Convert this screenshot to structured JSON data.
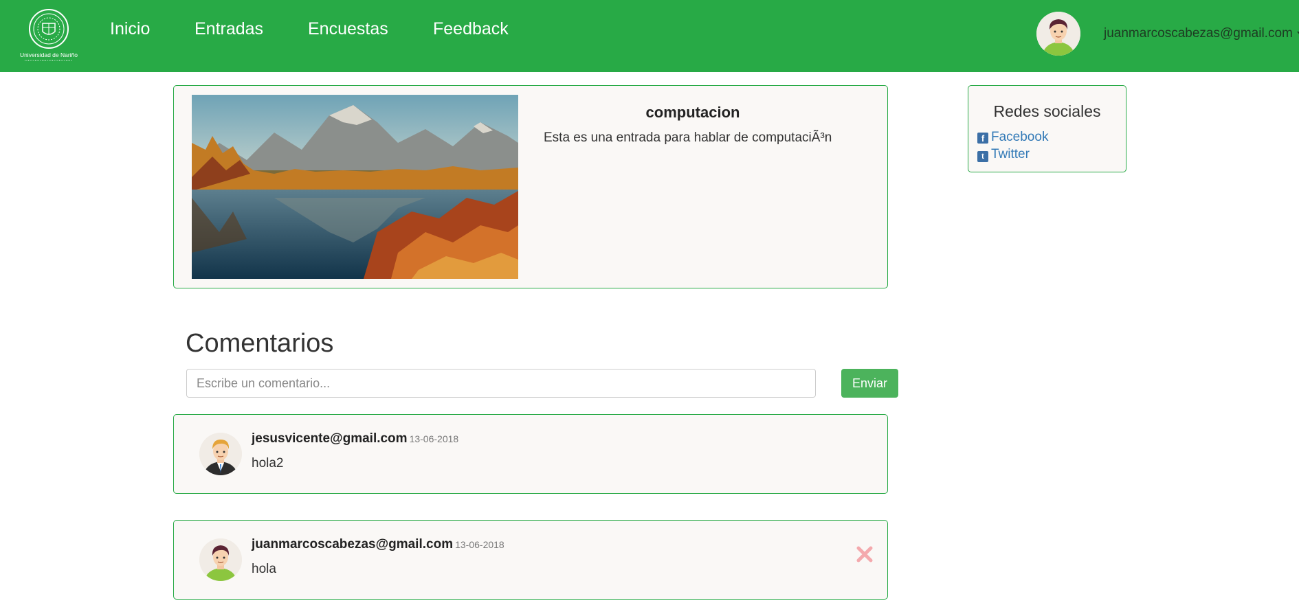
{
  "navbar": {
    "logo_text": "Universidad de Nariño",
    "links": [
      "Inicio",
      "Entradas",
      "Encuestas",
      "Feedback"
    ],
    "user_email": "juanmarcoscabezas@gmail.com"
  },
  "post": {
    "image": "landscape-mountain-lake-autumn",
    "title": "computacion",
    "body": "Esta es una entrada para hablar de computaciÃ³n"
  },
  "social": {
    "title": "Redes sociales",
    "facebook": "Facebook",
    "twitter": "Twitter"
  },
  "comments": {
    "heading": "Comentarios",
    "input_placeholder": "Escribe un comentario...",
    "send_label": "Enviar",
    "items": [
      {
        "author": "jesusvicente@gmail.com",
        "date": "13-06-2018",
        "text": "hola2",
        "deletable": false
      },
      {
        "author": "juanmarcoscabezas@gmail.com",
        "date": "13-06-2018",
        "text": "hola",
        "deletable": true
      }
    ]
  },
  "colors": {
    "brand": "#28aa46",
    "button": "#4cb35c",
    "link": "#337ab7",
    "delete": "#f4a9ad"
  },
  "icons": [
    "university-logo",
    "user-avatar",
    "facebook-icon",
    "twitter-icon",
    "close-icon",
    "caret-down-icon"
  ]
}
